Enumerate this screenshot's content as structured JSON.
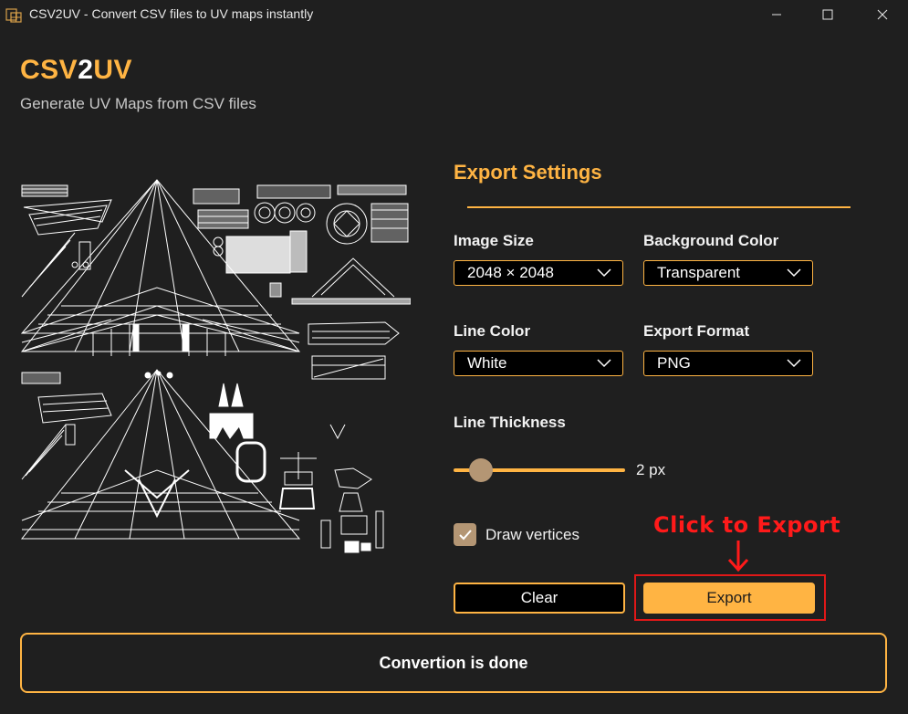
{
  "window": {
    "title": "CSV2UV - Convert CSV files to UV maps instantly"
  },
  "brand": {
    "part1": "CSV",
    "part2": "2",
    "part3": "UV",
    "subtitle": "Generate UV Maps from CSV files"
  },
  "settings": {
    "title": "Export Settings",
    "image_size": {
      "label": "Image Size",
      "value": "2048 × 2048"
    },
    "background_color": {
      "label": "Background Color",
      "value": "Transparent"
    },
    "line_color": {
      "label": "Line Color",
      "value": "White"
    },
    "export_format": {
      "label": "Export Format",
      "value": "PNG"
    },
    "line_thickness": {
      "label": "Line Thickness",
      "value_text": "2 px",
      "value": 2
    },
    "draw_vertices": {
      "label": "Draw vertices",
      "checked": true
    }
  },
  "buttons": {
    "clear": "Clear",
    "export": "Export"
  },
  "annotation": {
    "text": "Click to Export"
  },
  "status": {
    "text": "Convertion is done"
  },
  "colors": {
    "accent": "#ffb443",
    "background": "#1f1f1f",
    "annotation": "#ff1a1a",
    "thumb": "#b49674"
  },
  "icons": [
    "app-icon",
    "minimize-icon",
    "maximize-icon",
    "close-icon",
    "chevron-down-icon",
    "checkmark-icon",
    "arrow-down-icon"
  ]
}
